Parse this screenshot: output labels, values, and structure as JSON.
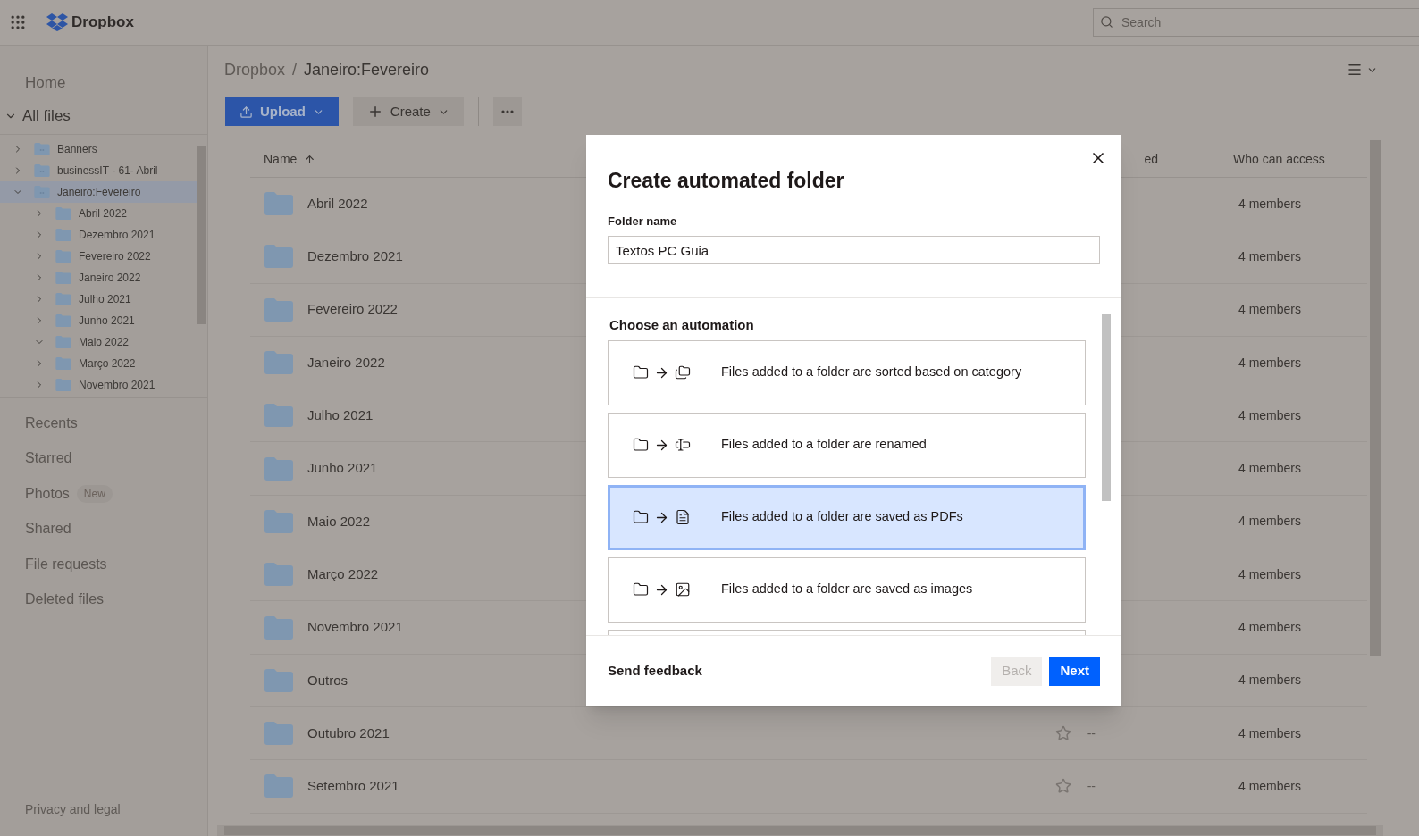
{
  "topbar": {
    "logo": "Dropbox",
    "search": {
      "placeholder": "Search"
    }
  },
  "sidebar": {
    "nav_top": [
      {
        "label": "Home",
        "selected": false
      },
      {
        "label": "All files",
        "selected": true,
        "expanded": true
      }
    ],
    "tree": [
      {
        "label": "Banners",
        "expanded": false,
        "selected": false,
        "kind": "team"
      },
      {
        "label": "businessIT - 61- Abril",
        "expanded": false,
        "selected": false,
        "kind": "team"
      },
      {
        "label": "Janeiro:Fevereiro",
        "expanded": true,
        "selected": true,
        "kind": "team",
        "children": [
          {
            "label": "Abril 2022",
            "expanded": false,
            "selected": false,
            "kind": "folder"
          },
          {
            "label": "Dezembro 2021",
            "expanded": false,
            "selected": false,
            "kind": "folder"
          },
          {
            "label": "Fevereiro 2022",
            "expanded": false,
            "selected": false,
            "kind": "folder"
          },
          {
            "label": "Janeiro 2022",
            "expanded": false,
            "selected": false,
            "kind": "folder"
          },
          {
            "label": "Julho 2021",
            "expanded": false,
            "selected": false,
            "kind": "folder"
          },
          {
            "label": "Junho 2021",
            "expanded": false,
            "selected": false,
            "kind": "folder"
          },
          {
            "label": "Maio 2022",
            "expanded": true,
            "selected": false,
            "kind": "folder"
          },
          {
            "label": "Março 2022",
            "expanded": false,
            "selected": false,
            "kind": "folder"
          },
          {
            "label": "Novembro 2021",
            "expanded": false,
            "selected": false,
            "kind": "folder"
          }
        ]
      }
    ],
    "nav": [
      {
        "label": "Recents"
      },
      {
        "label": "Starred"
      },
      {
        "label": "Photos",
        "badge": "New"
      },
      {
        "label": "Shared"
      },
      {
        "label": "File requests"
      },
      {
        "label": "Deleted files"
      }
    ],
    "footer": "Privacy and legal"
  },
  "breadcrumb": [
    "Dropbox",
    "Janeiro:Fevereiro"
  ],
  "breadcrumb_separator": "/",
  "toolbar": {
    "upload": "Upload",
    "create": "Create"
  },
  "table": {
    "columns": [
      {
        "label": "Name",
        "sorted": true
      },
      {
        "label": "ed"
      },
      {
        "label": "Who can access"
      }
    ],
    "rows": [
      {
        "name": "Abril 2022",
        "access": "4 members"
      },
      {
        "name": "Dezembro 2021",
        "access": "4 members"
      },
      {
        "name": "Fevereiro 2022",
        "access": "4 members"
      },
      {
        "name": "Janeiro 2022",
        "access": "4 members"
      },
      {
        "name": "Julho 2021",
        "access": "4 members"
      },
      {
        "name": "Junho 2021",
        "access": "4 members"
      },
      {
        "name": "Maio 2022",
        "access": "4 members"
      },
      {
        "name": "Março 2022",
        "access": "4 members"
      },
      {
        "name": "Novembro 2021",
        "access": "4 members"
      },
      {
        "name": "Outros",
        "access": "4 members"
      },
      {
        "name": "Outubro 2021",
        "modified": "--",
        "starred": false,
        "access": "4 members"
      },
      {
        "name": "Setembro 2021",
        "modified": "--",
        "starred": false,
        "access": "4 members"
      }
    ]
  },
  "dialog": {
    "title": "Create automated folder",
    "field_label": "Folder name",
    "field_value": "Textos PC Guia",
    "section_title": "Choose an automation",
    "options": [
      {
        "kind": "sort",
        "label": "Files added to a folder are sorted based on category",
        "selected": false
      },
      {
        "kind": "rename",
        "label": "Files added to a folder are renamed",
        "selected": false
      },
      {
        "kind": "pdf",
        "label": "Files added to a folder are saved as PDFs",
        "selected": true
      },
      {
        "kind": "image",
        "label": "Files added to a folder are saved as images",
        "selected": false
      }
    ],
    "feedback": "Send feedback",
    "back": {
      "label": "Back",
      "disabled": true
    },
    "next": {
      "label": "Next",
      "disabled": false
    }
  }
}
